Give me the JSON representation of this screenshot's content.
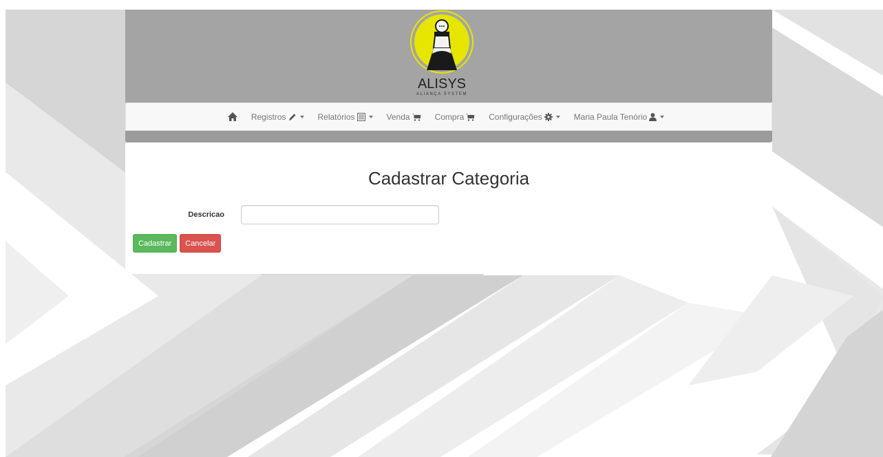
{
  "colors": {
    "banner": "#a4a4a4",
    "strip": "#9b9b9b",
    "logo_yellow": "#e6e600",
    "success": "#5cb85c",
    "danger": "#d9534f"
  },
  "logo": {
    "name": "ALISYS",
    "tagline": "ALIANÇA SYSTEM"
  },
  "nav": {
    "home_icon": "home-icon",
    "items": [
      {
        "label": "Registros",
        "icon": "pencil-icon",
        "dropdown": true
      },
      {
        "label": "Relatórios",
        "icon": "list-alt-icon",
        "dropdown": true
      },
      {
        "label": "Venda",
        "icon": "cart-icon",
        "dropdown": false
      },
      {
        "label": "Compra",
        "icon": "cart-icon",
        "dropdown": false
      },
      {
        "label": "Configurações",
        "icon": "cog-icon",
        "dropdown": true
      },
      {
        "label": "Maria Paula Tenório",
        "icon": "user-icon",
        "dropdown": true
      }
    ]
  },
  "page": {
    "title": "Cadastrar Categoria"
  },
  "form": {
    "descricao_label": "Descricao",
    "descricao_value": "",
    "descricao_placeholder": ""
  },
  "buttons": {
    "submit_label": "Cadastrar",
    "cancel_label": "Cancelar"
  }
}
